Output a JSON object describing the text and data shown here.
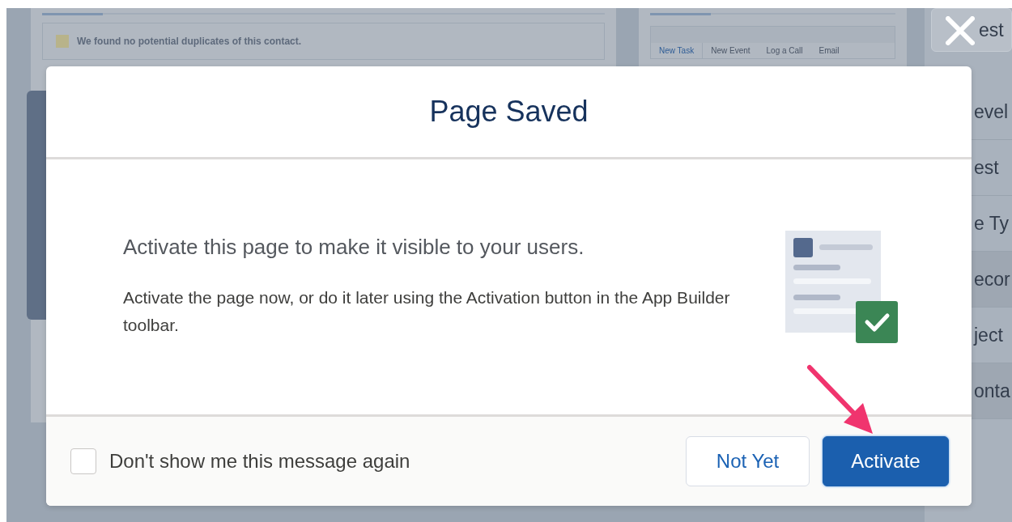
{
  "background": {
    "notice": "We found no potential duplicates of this contact.",
    "activity_tabs": [
      {
        "label": "New Task",
        "selected": true
      },
      {
        "label": "New Event",
        "selected": false
      },
      {
        "label": "Log a Call",
        "selected": false
      },
      {
        "label": "Email",
        "selected": false
      }
    ],
    "side_fields": [
      {
        "text": "est",
        "kind": "box"
      },
      {
        "text": "evel",
        "kind": "label"
      },
      {
        "text": "est",
        "kind": "label"
      },
      {
        "text": "e Ty",
        "kind": "label"
      },
      {
        "text": "ecor",
        "kind": "value"
      },
      {
        "text": "ject",
        "kind": "label"
      },
      {
        "text": "onta",
        "kind": "value"
      }
    ]
  },
  "dialog": {
    "title": "Page Saved",
    "heading": "Activate this page to make it visible to your users.",
    "message": "Activate the page now, or do it later using the Activation button in the App Builder toolbar.",
    "dont_show_again": {
      "label": "Don't show me this message again",
      "checked": false
    },
    "buttons": [
      {
        "label": "Not Yet",
        "kind": "neutral"
      },
      {
        "label": "Activate",
        "kind": "brand"
      }
    ]
  }
}
